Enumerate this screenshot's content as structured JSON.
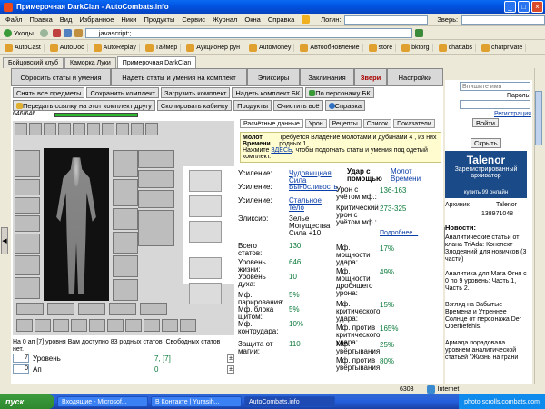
{
  "window": {
    "title": "Примерочная DarkClan - AutoCombats.info",
    "buttons": [
      "_",
      "□",
      "×"
    ]
  },
  "menu": {
    "items": [
      "Файл",
      "Правка",
      "Вид",
      "Избранное",
      "Ники",
      "Продукты",
      "Сервис",
      "Журнал",
      "Окна",
      "Справка"
    ],
    "login_label": "Логин:",
    "beast_label": "Зверь:"
  },
  "toolbar": {
    "back_label": "Уходы",
    "address": "javascript:;"
  },
  "links": [
    "AutoCast",
    "AutoDoc",
    "AutoReplay",
    "Таймер",
    "Аукционер рун",
    "AutoMoney",
    "Автообновление",
    "store",
    "bktorg",
    "chattabs",
    "chatprivate"
  ],
  "tabs": [
    "Бойцовский клуб",
    "Каморка Луки",
    "Примерочная DarkClan"
  ],
  "nav": {
    "row1": [
      "Сбросить статы и умения",
      "Надеть статы и умения на комплект",
      "Эликсиры",
      "Заклинания",
      "Звери",
      "Настройки"
    ],
    "row2_buttons": [
      "Снять все предметы",
      "Сохранить комплект",
      "Загрузить комплект",
      "Надеть комплект БК",
      "По персонажу БК"
    ],
    "row3_buttons": [
      "Передать ссылку на этот комплект другу",
      "Скопировать кабинку",
      "Продукты",
      "Очистить всё",
      "Справка"
    ]
  },
  "character": {
    "hp": "646/646",
    "hp_fraction": 1.0
  },
  "subtabs": [
    "Расчётные данные",
    "Урон",
    "Рецепты",
    "Список",
    "Показатели"
  ],
  "requirement": {
    "item_name": "Молот Времени",
    "text": "Требуется Владение молотами и дубинами 4 , из них родных 1",
    "hint_pre": "Нажмите",
    "hint_link": "ЗДЕСЬ",
    "hint_post": ", чтобы подогнать статы и умения под одетый комплект."
  },
  "stats_left": [
    {
      "label": "Усиление:",
      "value": "Чудовищная Сила"
    },
    {
      "label": "Усиление:",
      "value": "Выносливость"
    },
    {
      "label": "Усиление:",
      "value": "Стальное тело"
    },
    {
      "label": "Эликсир:",
      "value": "Зелье Могущества Сила +10"
    },
    {
      "label": "Всего статов:",
      "value": "130"
    },
    {
      "label": "Уровень жизни:",
      "value": "646"
    },
    {
      "label": "Уровень духа:",
      "value": "10"
    },
    {
      "label": "Мф. парирования:",
      "value": "5%"
    },
    {
      "label": "Мф. блока щитом:",
      "value": "5%"
    },
    {
      "label": "Мф. контрудара:",
      "value": "10%"
    },
    {
      "label": "Защита от магии:",
      "value": "110"
    }
  ],
  "stats_right_header": {
    "label": "Удар с помощью",
    "value": "Молот Времени"
  },
  "stats_right": [
    {
      "label": "Урон с учётом мф.:",
      "value": "136-163"
    },
    {
      "label": "Критический урон с учётом мф.:",
      "value": "273-325"
    },
    {
      "label": "Подробнее...",
      "value": ""
    },
    {
      "label": "Мф. мощности удара:",
      "value": "17%"
    },
    {
      "label": "Мф. мощности дробящего урона:",
      "value": "49%"
    },
    {
      "label": "Мф. критического удара:",
      "value": "15%"
    },
    {
      "label": "Мф. против критического удара:",
      "value": "165%"
    },
    {
      "label": "Мф. увёртывания:",
      "value": "25%"
    },
    {
      "label": "Мф. против увёртывания:",
      "value": "80%"
    }
  ],
  "bottom": {
    "notice": "На 0 ап [7] уровня Вам доступно 83 родных статов. Свободных статов нет.",
    "rows": [
      {
        "count": "7",
        "label": "Уровень",
        "value": "7, [7]"
      },
      {
        "count": "0",
        "label": "Ап",
        "value": "0"
      }
    ]
  },
  "sidebar": {
    "login_placeholder": "Впишите имя",
    "password_label": "Пароль:",
    "register_link": "Регистрация",
    "login_button": "Войти",
    "hide_button": "Скрыть",
    "ad_title": "Talenor",
    "ad_subtitle": "Зарегистрированный архиватор",
    "ad_price": "купить 99 онлайн",
    "archive_label": "Архиник",
    "user_label": "Talenor",
    "user_id": "138971048",
    "news_title": "Новости:",
    "news_items": [
      "Аналитические статьи от клана TriAda: Конспект Злодеяний для новичков (3 части)",
      "Аналитика для Мага Огня с 0 по 9 уровень: Часть 1, Часть 2.",
      "Взгляд на Забытые Времена и Утреннее Солнце от персонажа Der Oberbefehls.",
      "Армада порадовала уровнем аналитической статьей \"Жизнь на грани"
    ]
  },
  "statusbar": {
    "count": "6303",
    "zone": "Internet"
  },
  "taskbar": {
    "start": "пуск",
    "items": [
      "Входящие - Microsof...",
      "В Контакте | Yurasih...",
      "AutoCombats.info"
    ],
    "watermark": "photo.scrolls.combats.com"
  },
  "colors": {
    "hp_bar": "#2fb52f",
    "red_tab": "#a80000",
    "link": "#0a3ea8",
    "stat_value": "#0a7a3a"
  }
}
